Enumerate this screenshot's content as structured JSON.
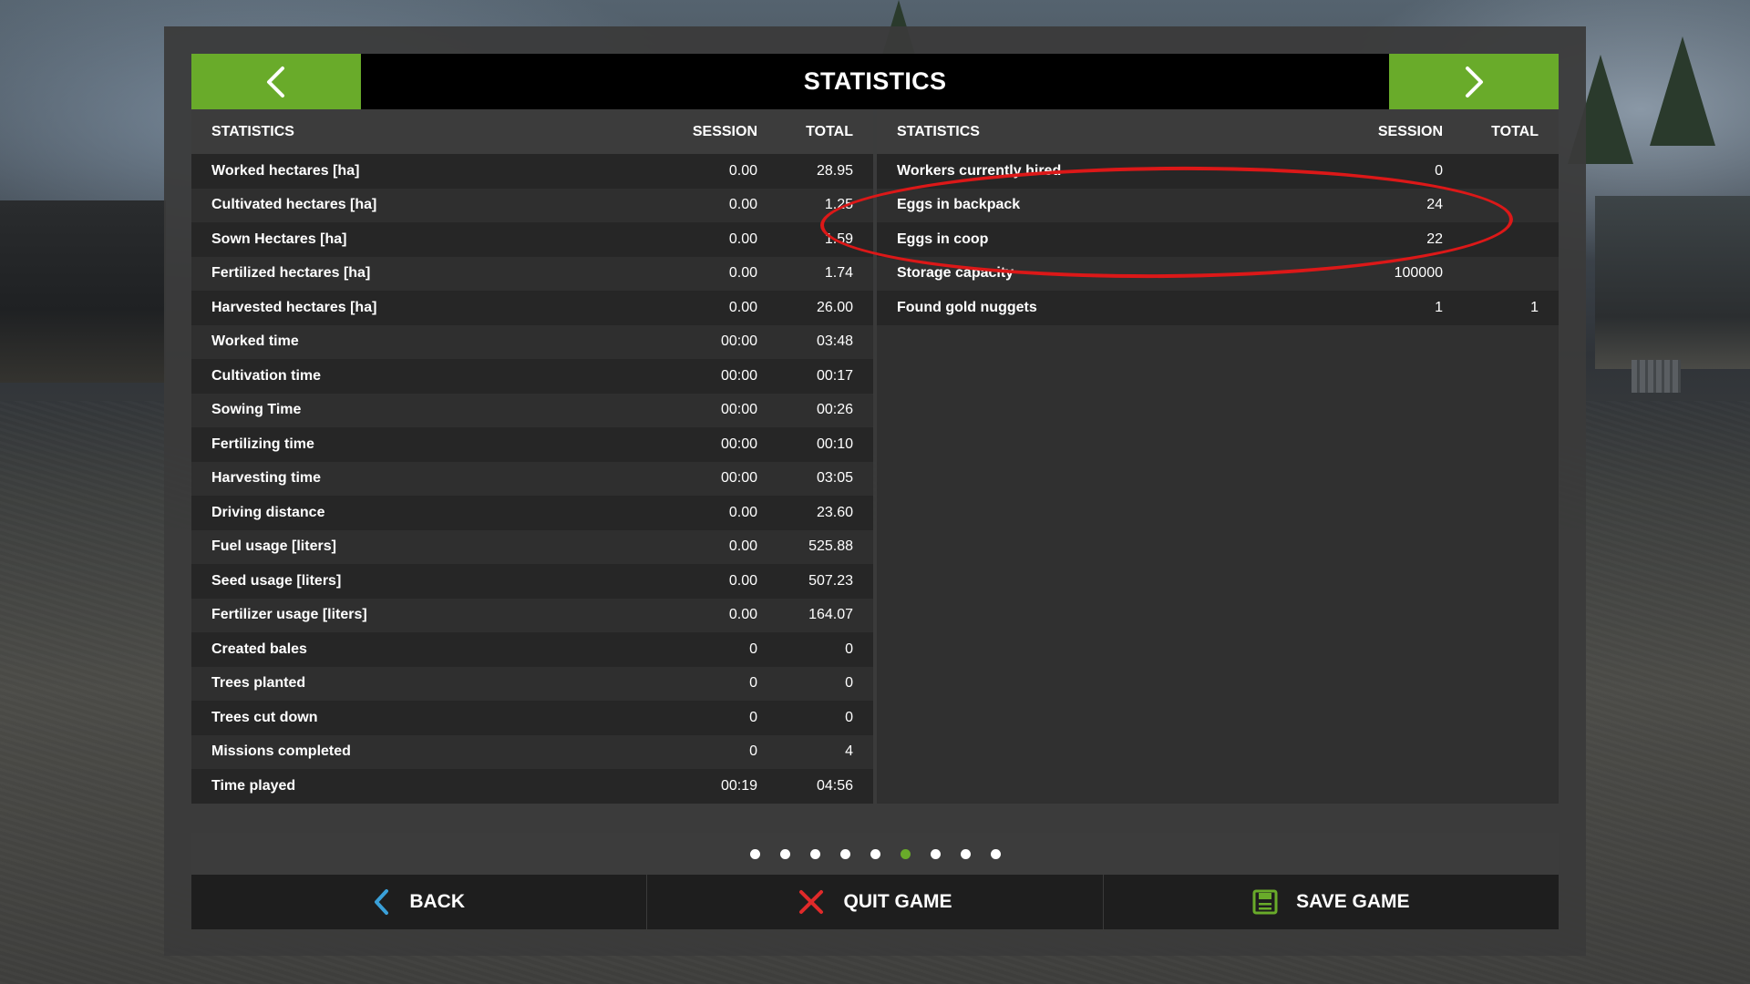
{
  "header": {
    "title": "STATISTICS",
    "prev_icon": "chevron-left-icon",
    "next_icon": "chevron-right-icon"
  },
  "left_table": {
    "columns": [
      "STATISTICS",
      "SESSION",
      "TOTAL"
    ],
    "rows": [
      {
        "name": "Worked hectares [ha]",
        "session": "0.00",
        "total": "28.95"
      },
      {
        "name": "Cultivated hectares [ha]",
        "session": "0.00",
        "total": "1.25"
      },
      {
        "name": "Sown Hectares [ha]",
        "session": "0.00",
        "total": "1.59"
      },
      {
        "name": "Fertilized hectares [ha]",
        "session": "0.00",
        "total": "1.74"
      },
      {
        "name": "Harvested hectares [ha]",
        "session": "0.00",
        "total": "26.00"
      },
      {
        "name": "Worked time",
        "session": "00:00",
        "total": "03:48"
      },
      {
        "name": "Cultivation time",
        "session": "00:00",
        "total": "00:17"
      },
      {
        "name": "Sowing Time",
        "session": "00:00",
        "total": "00:26"
      },
      {
        "name": "Fertilizing time",
        "session": "00:00",
        "total": "00:10"
      },
      {
        "name": "Harvesting time",
        "session": "00:00",
        "total": "03:05"
      },
      {
        "name": "Driving distance",
        "session": "0.00",
        "total": "23.60"
      },
      {
        "name": "Fuel usage [liters]",
        "session": "0.00",
        "total": "525.88"
      },
      {
        "name": "Seed usage [liters]",
        "session": "0.00",
        "total": "507.23"
      },
      {
        "name": "Fertilizer usage [liters]",
        "session": "0.00",
        "total": "164.07"
      },
      {
        "name": "Created bales",
        "session": "0",
        "total": "0"
      },
      {
        "name": "Trees planted",
        "session": "0",
        "total": "0"
      },
      {
        "name": "Trees cut down",
        "session": "0",
        "total": "0"
      },
      {
        "name": "Missions completed",
        "session": "0",
        "total": "4"
      },
      {
        "name": "Time played",
        "session": "00:19",
        "total": "04:56"
      }
    ]
  },
  "right_table": {
    "columns": [
      "STATISTICS",
      "SESSION",
      "TOTAL"
    ],
    "rows": [
      {
        "name": "Workers currently hired",
        "session": "0",
        "total": ""
      },
      {
        "name": "Eggs in backpack",
        "session": "24",
        "total": ""
      },
      {
        "name": "Eggs in coop",
        "session": "22",
        "total": ""
      },
      {
        "name": "Storage capacity",
        "session": "100000",
        "total": ""
      },
      {
        "name": "Found gold nuggets",
        "session": "1",
        "total": "1"
      }
    ]
  },
  "pager": {
    "page_count": 9,
    "active_page": 6
  },
  "footer": {
    "back_label": "BACK",
    "back_icon": "chevron-left-icon",
    "quit_label": "QUIT GAME",
    "quit_icon": "close-x-icon",
    "save_label": "SAVE GAME",
    "save_icon": "floppy-disk-icon"
  },
  "colors": {
    "accent_green": "#69ab2a",
    "header_black": "#000000",
    "annotation_red": "#dc1818",
    "back_icon_blue": "#3aa0d8",
    "quit_icon_red": "#e02a2a"
  }
}
